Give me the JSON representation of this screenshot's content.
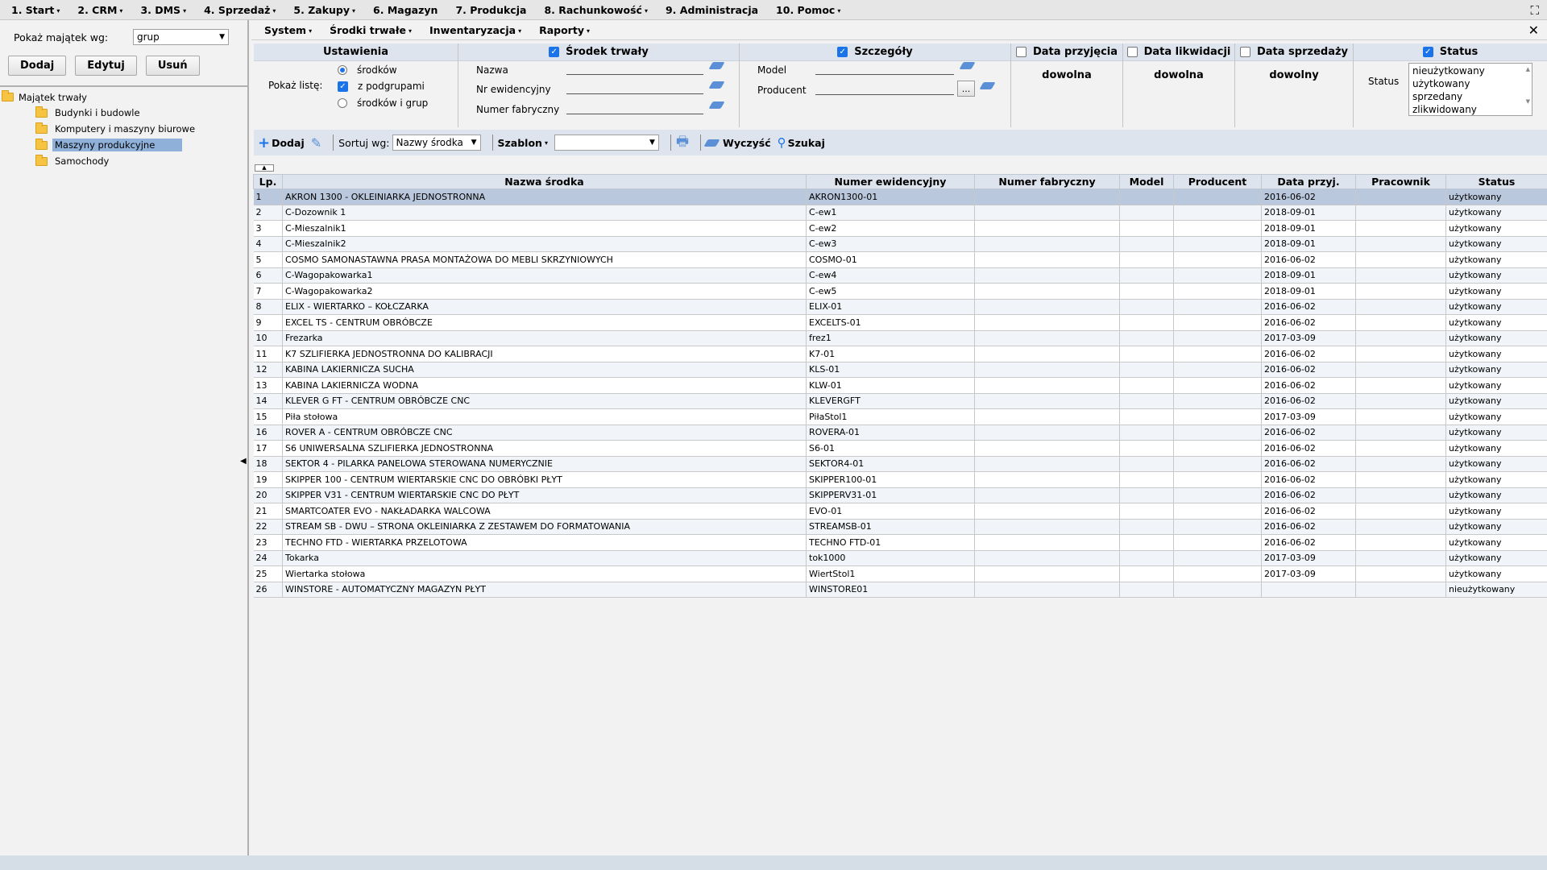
{
  "topmenu": [
    "1. Start",
    "2. CRM",
    "3. DMS",
    "4. Sprzedaż",
    "5. Zakupy",
    "6. Magazyn",
    "7. Produkcja",
    "8. Rachunkowość",
    "9. Administracja",
    "10. Pomoc"
  ],
  "left": {
    "showby_label": "Pokaż majątek wg:",
    "showby_value": "grup",
    "buttons": {
      "add": "Dodaj",
      "edit": "Edytuj",
      "delete": "Usuń"
    },
    "tree_root": "Majątek trwały",
    "tree_items": [
      "Budynki i budowle",
      "Komputery i maszyny biurowe",
      "Maszyny produkcyjne",
      "Samochody"
    ]
  },
  "submenu": [
    "System",
    "Środki trwałe",
    "Inwentaryzacja",
    "Raporty"
  ],
  "filters": {
    "settings": {
      "title": "Ustawienia",
      "show_list": "Pokaż listę:",
      "opt1": "środków",
      "opt2": "z podgrupami",
      "opt3": "środków i grup"
    },
    "asset": {
      "title": "Środek trwały",
      "name": "Nazwa",
      "inv": "Nr ewidencyjny",
      "serial": "Numer fabryczny"
    },
    "details": {
      "title": "Szczegóły",
      "model": "Model",
      "producer": "Producent",
      "dots": "..."
    },
    "date_in": {
      "title": "Data przyjęcia",
      "value": "dowolna"
    },
    "date_liq": {
      "title": "Data likwidacji",
      "value": "dowolna"
    },
    "date_sale": {
      "title": "Data sprzedaży",
      "value": "dowolny"
    },
    "status": {
      "title": "Status",
      "label": "Status",
      "options": [
        "nieużytkowany",
        "użytkowany",
        "sprzedany",
        "zlikwidowany"
      ]
    }
  },
  "toolbar": {
    "add": "Dodaj",
    "sort_label": "Sortuj wg:",
    "sort_value": "Nazwy środka",
    "template": "Szablon",
    "clear": "Wyczyść",
    "search": "Szukaj"
  },
  "table": {
    "headers": [
      "Lp.",
      "Nazwa środka",
      "Numer ewidencyjny",
      "Numer fabryczny",
      "Model",
      "Producent",
      "Data przyj.",
      "Pracownik",
      "Status"
    ],
    "rows": [
      [
        "1",
        "AKRON 1300 - OKLEINIARKA JEDNOSTRONNA",
        "AKRON1300-01",
        "",
        "",
        "",
        "2016-06-02",
        "",
        "użytkowany"
      ],
      [
        "2",
        "C-Dozownik 1",
        "C-ew1",
        "",
        "",
        "",
        "2018-09-01",
        "",
        "użytkowany"
      ],
      [
        "3",
        "C-Mieszalnik1",
        "C-ew2",
        "",
        "",
        "",
        "2018-09-01",
        "",
        "użytkowany"
      ],
      [
        "4",
        "C-Mieszalnik2",
        "C-ew3",
        "",
        "",
        "",
        "2018-09-01",
        "",
        "użytkowany"
      ],
      [
        "5",
        "COSMO SAMONASTAWNA PRASA MONTAŻOWA DO MEBLI SKRZYNIOWYCH",
        "COSMO-01",
        "",
        "",
        "",
        "2016-06-02",
        "",
        "użytkowany"
      ],
      [
        "6",
        "C-Wagopakowarka1",
        "C-ew4",
        "",
        "",
        "",
        "2018-09-01",
        "",
        "użytkowany"
      ],
      [
        "7",
        "C-Wagopakowarka2",
        "C-ew5",
        "",
        "",
        "",
        "2018-09-01",
        "",
        "użytkowany"
      ],
      [
        "8",
        "ELIX - WIERTARKO – KOŁCZARKA",
        "ELIX-01",
        "",
        "",
        "",
        "2016-06-02",
        "",
        "użytkowany"
      ],
      [
        "9",
        "EXCEL TS - CENTRUM OBRÓBCZE",
        "EXCELTS-01",
        "",
        "",
        "",
        "2016-06-02",
        "",
        "użytkowany"
      ],
      [
        "10",
        "Frezarka",
        "frez1",
        "",
        "",
        "",
        "2017-03-09",
        "",
        "użytkowany"
      ],
      [
        "11",
        "K7 SZLIFIERKA JEDNOSTRONNA DO KALIBRACJI",
        "K7-01",
        "",
        "",
        "",
        "2016-06-02",
        "",
        "użytkowany"
      ],
      [
        "12",
        "KABINA LAKIERNICZA SUCHA",
        "KLS-01",
        "",
        "",
        "",
        "2016-06-02",
        "",
        "użytkowany"
      ],
      [
        "13",
        "KABINA LAKIERNICZA WODNA",
        "KLW-01",
        "",
        "",
        "",
        "2016-06-02",
        "",
        "użytkowany"
      ],
      [
        "14",
        "KLEVER G FT - CENTRUM OBRÓBCZE CNC",
        "KLEVERGFT",
        "",
        "",
        "",
        "2016-06-02",
        "",
        "użytkowany"
      ],
      [
        "15",
        "Piła stołowa",
        "PiłaStol1",
        "",
        "",
        "",
        "2017-03-09",
        "",
        "użytkowany"
      ],
      [
        "16",
        "ROVER A - CENTRUM OBRÓBCZE CNC",
        "ROVERA-01",
        "",
        "",
        "",
        "2016-06-02",
        "",
        "użytkowany"
      ],
      [
        "17",
        "S6 UNIWERSALNA SZLIFIERKA JEDNOSTRONNA",
        "S6-01",
        "",
        "",
        "",
        "2016-06-02",
        "",
        "użytkowany"
      ],
      [
        "18",
        "SEKTOR 4 - PILARKA PANELOWA STEROWANA NUMERYCZNIE",
        "SEKTOR4-01",
        "",
        "",
        "",
        "2016-06-02",
        "",
        "użytkowany"
      ],
      [
        "19",
        "SKIPPER 100 - CENTRUM WIERTARSKIE CNC DO OBRÓBKI PŁYT",
        "SKIPPER100-01",
        "",
        "",
        "",
        "2016-06-02",
        "",
        "użytkowany"
      ],
      [
        "20",
        "SKIPPER V31 - CENTRUM WIERTARSKIE CNC DO PŁYT",
        "SKIPPERV31-01",
        "",
        "",
        "",
        "2016-06-02",
        "",
        "użytkowany"
      ],
      [
        "21",
        "SMARTCOATER EVO - NAKŁADARKA WALCOWA",
        "EVO-01",
        "",
        "",
        "",
        "2016-06-02",
        "",
        "użytkowany"
      ],
      [
        "22",
        "STREAM SB - DWU – STRONA OKLEINIARKA Z ZESTAWEM DO FORMATOWANIA",
        "STREAMSB-01",
        "",
        "",
        "",
        "2016-06-02",
        "",
        "użytkowany"
      ],
      [
        "23",
        "TECHNO FTD - WIERTARKA PRZELOTOWA",
        "TECHNO FTD-01",
        "",
        "",
        "",
        "2016-06-02",
        "",
        "użytkowany"
      ],
      [
        "24",
        "Tokarka",
        "tok1000",
        "",
        "",
        "",
        "2017-03-09",
        "",
        "użytkowany"
      ],
      [
        "25",
        "Wiertarka stołowa",
        "WiertStol1",
        "",
        "",
        "",
        "2017-03-09",
        "",
        "użytkowany"
      ],
      [
        "26",
        "WINSTORE - AUTOMATYCZNY MAGAZYN PŁYT",
        "WINSTORE01",
        "",
        "",
        "",
        "",
        "",
        "nieużytkowany"
      ]
    ]
  }
}
